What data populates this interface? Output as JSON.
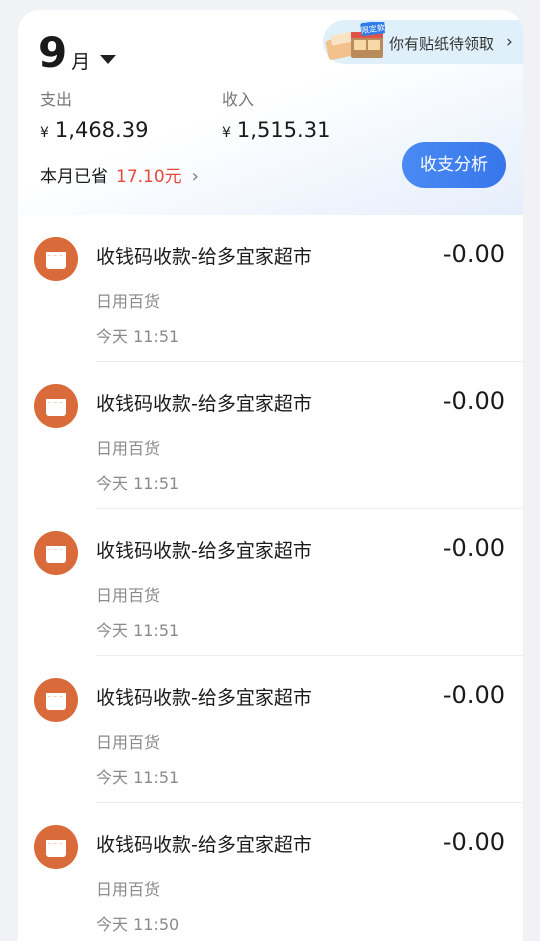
{
  "header": {
    "month_number": "9",
    "month_unit": "月",
    "promo": {
      "badge": "限定款",
      "label": "你有贴纸待领取"
    },
    "expense": {
      "label": "支出",
      "currency": "¥",
      "value": "1,468.39"
    },
    "income": {
      "label": "收入",
      "currency": "¥",
      "value": "1,515.31"
    },
    "saved": {
      "label": "本月已省",
      "amount": "17.10元"
    },
    "analysis_button": "收支分析"
  },
  "transactions": [
    {
      "title": "收钱码收款-给多宜家超市",
      "category": "日用百货",
      "time": "今天 11:51",
      "amount": "-0.00"
    },
    {
      "title": "收钱码收款-给多宜家超市",
      "category": "日用百货",
      "time": "今天 11:51",
      "amount": "-0.00"
    },
    {
      "title": "收钱码收款-给多宜家超市",
      "category": "日用百货",
      "time": "今天 11:51",
      "amount": "-0.00"
    },
    {
      "title": "收钱码收款-给多宜家超市",
      "category": "日用百货",
      "time": "今天 11:51",
      "amount": "-0.00"
    },
    {
      "title": "收钱码收款-给多宜家超市",
      "category": "日用百货",
      "time": "今天 11:50",
      "amount": "-0.00"
    }
  ],
  "colors": {
    "accent_blue": "#3f82f0",
    "saved_red": "#e24a3c",
    "store_icon": "#d96a3a"
  },
  "icons": {
    "month_dropdown": "caret-down-icon",
    "transaction": "store-icon",
    "chevron": "chevron-right-icon"
  }
}
